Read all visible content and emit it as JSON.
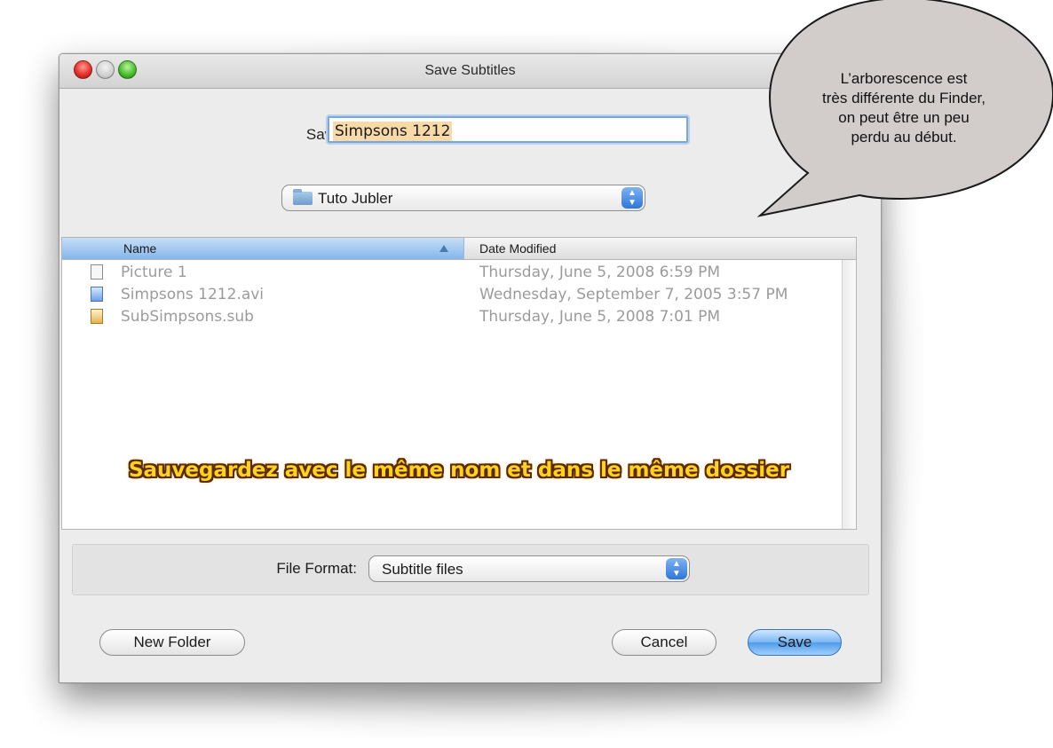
{
  "window": {
    "title": "Save Subtitles"
  },
  "save_as": {
    "label": "Save As:",
    "value": "Simpsons 1212"
  },
  "location": {
    "folder": "Tuto Jubler"
  },
  "browser": {
    "columns": {
      "name": "Name",
      "date": "Date Modified"
    },
    "files": [
      {
        "name": "Picture 1",
        "date": "Thursday, June 5, 2008 6:59 PM",
        "icon": "image-file-icon"
      },
      {
        "name": "Simpsons 1212.avi",
        "date": "Wednesday, September 7, 2005 3:57 PM",
        "icon": "video-file-icon"
      },
      {
        "name": "SubSimpsons.sub",
        "date": "Thursday, June 5, 2008 7:01 PM",
        "icon": "subtitle-file-icon"
      }
    ]
  },
  "annotation": "Sauvegardez avec le même nom et dans le même dossier",
  "format": {
    "label": "File Format:",
    "value": "Subtitle files"
  },
  "buttons": {
    "new_folder": "New Folder",
    "cancel": "Cancel",
    "save": "Save"
  },
  "bubble": {
    "line1": "L’arborescence est",
    "line2": "très différente du Finder,",
    "line3": "on peut être un peu",
    "line4": "perdu au début."
  }
}
